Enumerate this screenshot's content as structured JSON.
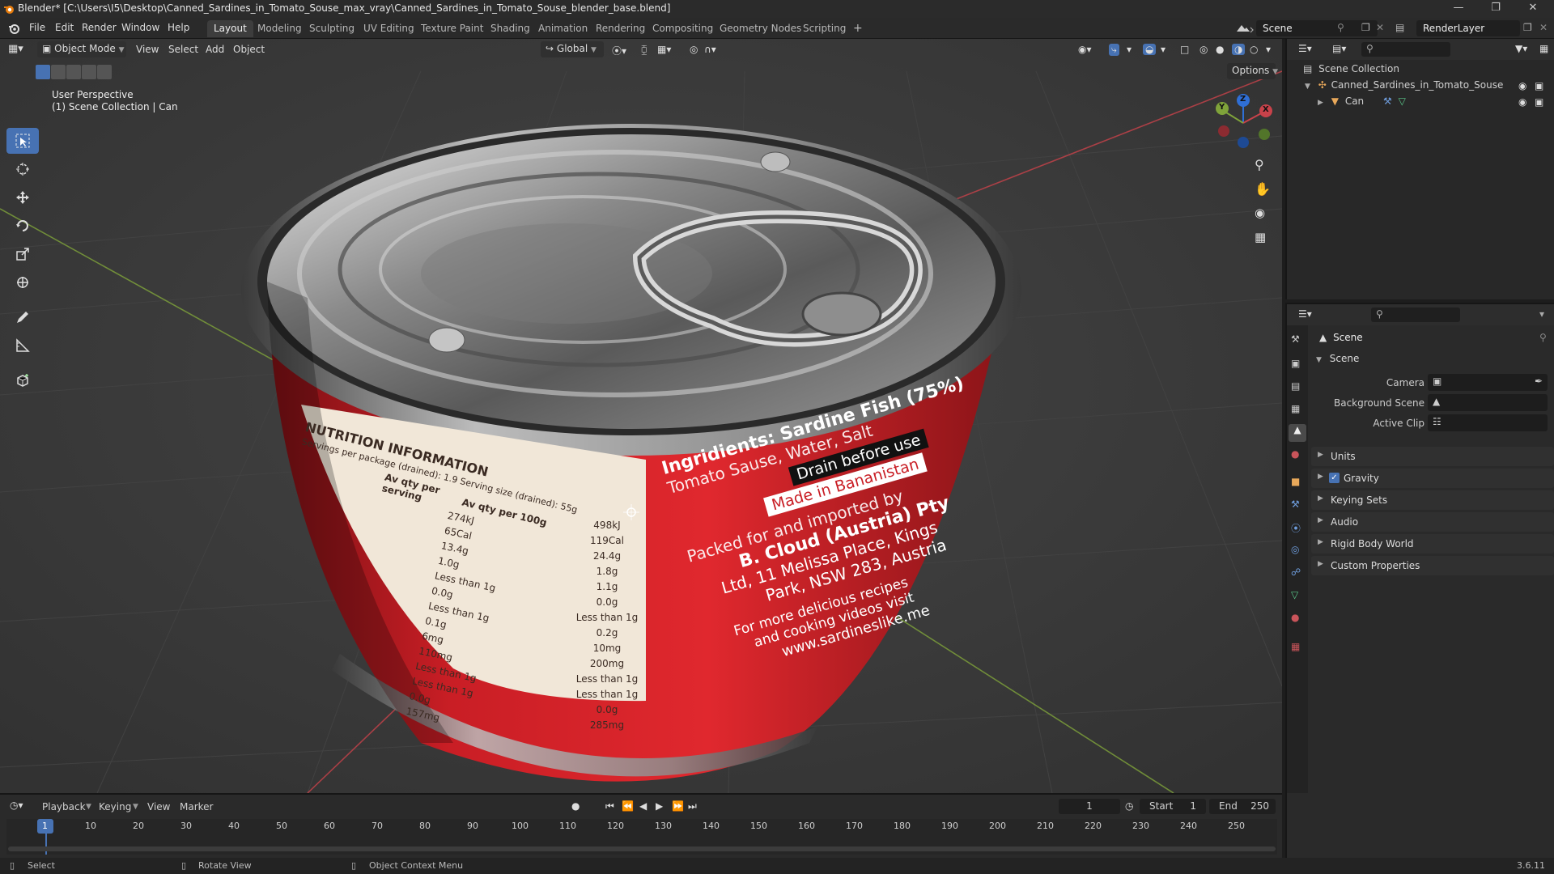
{
  "window": {
    "title": "Blender* [C:\\Users\\I5\\Desktop\\Canned_Sardines_in_Tomato_Souse_max_vray\\Canned_Sardines_in_Tomato_Souse_blender_base.blend]"
  },
  "menubar": {
    "menus": [
      "File",
      "Edit",
      "Render",
      "Window",
      "Help"
    ],
    "workspaces": [
      "Layout",
      "Modeling",
      "Sculpting",
      "UV Editing",
      "Texture Paint",
      "Shading",
      "Animation",
      "Rendering",
      "Compositing",
      "Geometry Nodes",
      "Scripting"
    ],
    "active_workspace": "Layout",
    "add_tab": "+",
    "scene": "Scene",
    "view_layer": "RenderLayer"
  },
  "viewport_header": {
    "mode": "Object Mode",
    "menus": [
      "View",
      "Select",
      "Add",
      "Object"
    ],
    "orientation": "Global",
    "options": "Options"
  },
  "viewport": {
    "perspective": "User Perspective",
    "collection": "(1) Scene Collection | Can",
    "gizmo": {
      "x": "X",
      "y": "Y",
      "z": "Z"
    },
    "label": {
      "nutrition_title": "NUTRITION INFORMATION",
      "servings": "Servings per package (drained): 1.9 Serving size (drained): 55g",
      "col_serving": "Av qty per serving",
      "col_100g": "Av qty per 100g",
      "rows_serving": [
        "274kJ",
        "65Cal",
        "13.4g",
        "1.0g",
        "Less than 1g",
        "0.0g",
        "Less than 1g",
        "0.1g",
        "6mg",
        "110mg",
        "Less than 1g",
        "Less than 1g",
        "0.0g",
        "157mg"
      ],
      "rows_100g": [
        "498kJ",
        "119Cal",
        "24.4g",
        "1.8g",
        "1.1g",
        "0.0g",
        "Less than 1g",
        "0.2g",
        "10mg",
        "200mg",
        "Less than 1g",
        "Less than 1g",
        "0.0g",
        "285mg"
      ],
      "ingredients": "Ingridients: Sardine Fish (75%)",
      "ingredients2": "Tomato Sause, Water, Salt",
      "drain": "Drain before use",
      "made_in": "Made in Bananistan",
      "packed1": "Packed for and imported by",
      "packed2": "B. Cloud (Austria) Pty",
      "packed3": "Ltd, 11 Melissa Place, Kings",
      "packed4": "Park, NSW 283, Austria",
      "recipes1": "For more delicious recipes",
      "recipes2": "and cooking videos visit",
      "website": "www.sardineslike.me"
    }
  },
  "outliner": {
    "root": "Scene Collection",
    "items": [
      {
        "label": "Canned_Sardines_in_Tomato_Souse"
      },
      {
        "label": "Can"
      }
    ]
  },
  "properties": {
    "context": "Scene",
    "panel_title": "Scene",
    "fields": [
      {
        "label": "Camera"
      },
      {
        "label": "Background Scene"
      },
      {
        "label": "Active Clip"
      }
    ],
    "panels": [
      "Units",
      "Gravity",
      "Keying Sets",
      "Audio",
      "Rigid Body World",
      "Custom Properties"
    ],
    "gravity_enabled": true
  },
  "timeline": {
    "menus": [
      "Playback",
      "Keying",
      "View",
      "Marker"
    ],
    "current_frame": "1",
    "start_label": "Start",
    "start": "1",
    "end_label": "End",
    "end": "250",
    "ticks": [
      "1",
      "10",
      "20",
      "30",
      "40",
      "50",
      "60",
      "70",
      "80",
      "90",
      "100",
      "110",
      "120",
      "130",
      "140",
      "150",
      "160",
      "170",
      "180",
      "190",
      "200",
      "210",
      "220",
      "230",
      "240",
      "250"
    ]
  },
  "statusbar": {
    "select": "Select",
    "rotate": "Rotate View",
    "context_menu": "Object Context Menu",
    "version": "3.6.11"
  },
  "colors": {
    "accent": "#4772b3",
    "can_red": "#d9242b",
    "axis_x": "#c8424a",
    "axis_y": "#7fa33a"
  }
}
